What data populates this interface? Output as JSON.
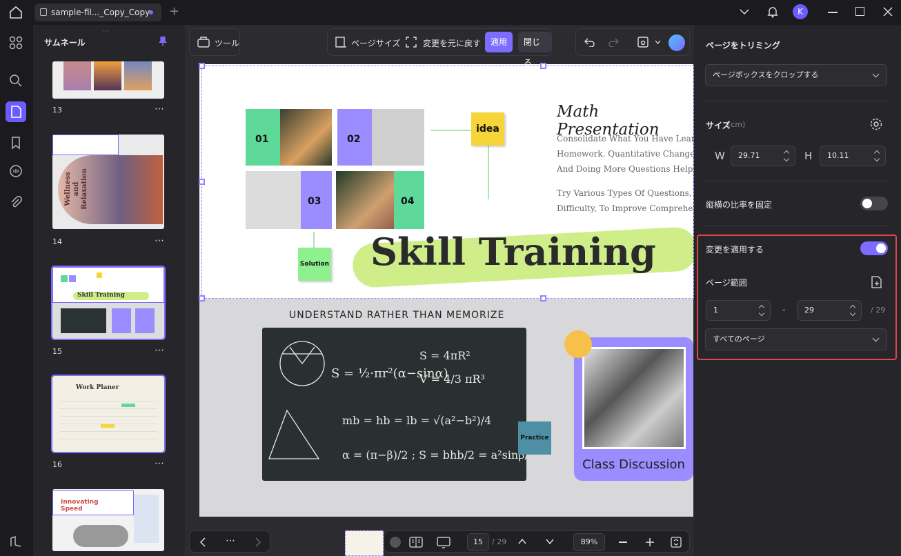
{
  "titlebar": {
    "tab_title": "sample-fil..._Copy_Copy",
    "avatar_letter": "K"
  },
  "thumbnails": {
    "title": "サムネール",
    "pages": [
      {
        "number": "13"
      },
      {
        "number": "14",
        "text": "Wellness and Relaxation"
      },
      {
        "number": "15",
        "text": "Skill Training"
      },
      {
        "number": "16",
        "text": "Work Planer"
      },
      {
        "number": "",
        "text": "Innovating Speed"
      }
    ]
  },
  "toolbar": {
    "tool_label": "ツール",
    "page_size_label": "ページサイズ",
    "revert_label": "変更を元に戻す",
    "apply_label": "適用",
    "close_label": "閉じる"
  },
  "slide": {
    "title": "Math Presentation",
    "body1": "Consolidate What You Have Learned Homework. Quantitative Changes Lea And Doing More Questions Helps Dee",
    "body1_lines": [
      "Consolidate What You Have Learned",
      "Homework. Quantitative Changes Lea",
      "And Doing More Questions Helps Dee"
    ],
    "body2_lines": [
      "Try Various Types Of Questions, C",
      "Difficulty, To Improve Comprehensiv"
    ],
    "idea": "idea",
    "solution": "Solution",
    "headline": "Skill Training",
    "tile_labels": [
      "01",
      "02",
      "03",
      "04"
    ],
    "subhead": "UNDERSTAND RATHER THAN MEMORIZE",
    "practice": "Practice",
    "class_discussion": "Class Discussion"
  },
  "bottom": {
    "current_page": "15",
    "total_pages": "/ 29",
    "zoom": "89%"
  },
  "panel": {
    "title": "ページをトリミング",
    "crop_select": "ページボックスをクロップする",
    "size_label": "サイズ",
    "size_unit": "(cm)",
    "w_label": "W",
    "w_value": "29.71",
    "h_label": "H",
    "h_value": "10.11",
    "lock_ratio_label": "縦横の比率を固定",
    "lock_ratio_on": false,
    "apply_changes_label": "変更を適用する",
    "apply_changes_on": true,
    "page_range_label": "ページ範囲",
    "range_from": "1",
    "range_dash": "-",
    "range_to": "29",
    "range_total": "/ 29",
    "range_select": "すべてのページ"
  },
  "colors": {
    "accent": "#7c6cff",
    "highlight_box": "#e04848",
    "green": "#5fd99a",
    "yellow": "#f5d53a",
    "purple": "#9b8cff"
  }
}
